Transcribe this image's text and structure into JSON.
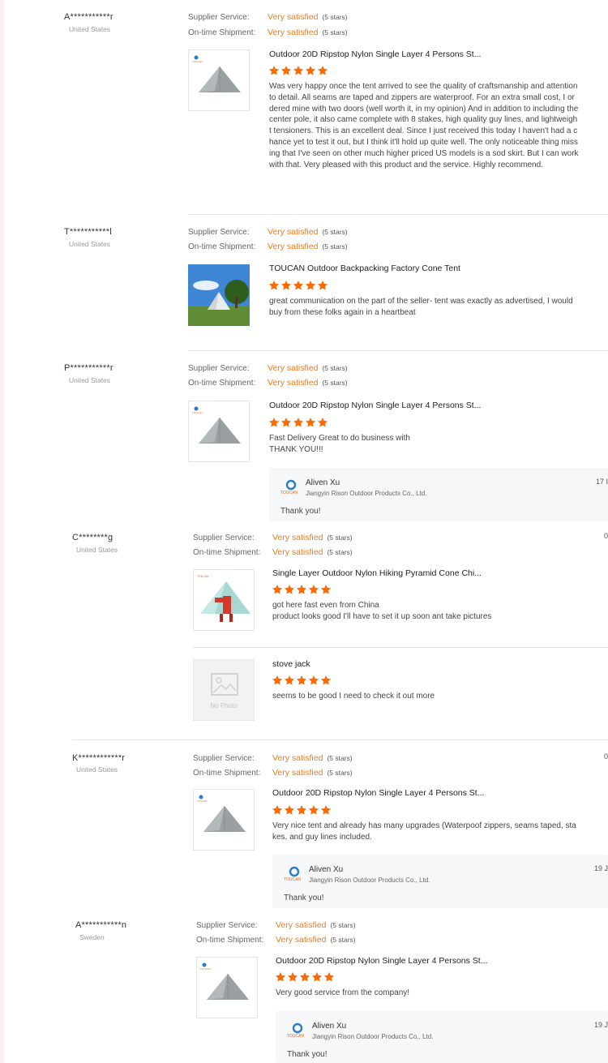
{
  "labels": {
    "supplier_service": "Supplier Service:",
    "ontime_shipment": "On-time Shipment:",
    "stars_note": "(5 stars)",
    "no_photo": "No Photo"
  },
  "reviews": [
    {
      "buyer": "A***********r",
      "country": "United States",
      "supplier_service": "Very satisfied",
      "ontime_shipment": "Very satisfied",
      "product_title": "Outdoor 20D Ripstop Nylon Single Layer 4 Persons St...",
      "rating": 5,
      "text": "Was very happy once the tent arrived to see the quality of craftsmanship and attention to detail. All seams are taped and zippers are waterproof. For an extra small cost, I ordered mine with two doors (well worth it, in my opinion) And in addition to including the center pole, it also came complete with 8 stakes, high quality guy lines, and lightweight tensioners. This is an excellent deal. Since I just received this today I haven't had a chance yet to test it out, but I think it'll hold up quite well. The only noticeable thing missing that I've seen on other much higher priced US models is a sod skirt. But I can work with that. Very pleased with this product and the service. Highly recommend."
    },
    {
      "buyer": "T***********l",
      "country": "United States",
      "supplier_service": "Very satisfied",
      "ontime_shipment": "Very satisfied",
      "product_title": "TOUCAN Outdoor Backpacking Factory Cone Tent",
      "rating": 5,
      "text": "great communication on the part of the seller- tent was exactly as advertised, I would buy from these folks again in a heartbeat"
    },
    {
      "buyer": "P***********r",
      "country": "United States",
      "supplier_service": "Very satisfied",
      "ontime_shipment": "Very satisfied",
      "product_title": "Outdoor 20D Ripstop Nylon Single Layer 4 Persons St...",
      "rating": 5,
      "text_line1": "Fast Delivery Great to do business with",
      "text_line2": "THANK YOU!!!",
      "reply": {
        "name": "Aliven Xu",
        "company": "Jiangyin Rison Outdoor Products Co., Ltd.",
        "message": "Thank you!",
        "date": "17 I"
      }
    },
    {
      "buyer": "C********g",
      "country": "United States",
      "supplier_service": "Very satisfied",
      "ontime_shipment": "Very satisfied",
      "edge_date": "0",
      "product_title": "Single Layer Outdoor Nylon Hiking Pyramid Cone Chi...",
      "rating": 5,
      "text_line1": "got here fast even from China",
      "text_line2": "product looks good I'll have to set it up soon ant take pictures",
      "extra_item": {
        "title": "stove jack",
        "rating": 5,
        "text": "seems to be good I need to check it out more"
      }
    },
    {
      "buyer": "K************r",
      "country": "United States",
      "supplier_service": "Very satisfied",
      "ontime_shipment": "Very satisfied",
      "edge_date": "0",
      "product_title": "Outdoor 20D Ripstop Nylon Single Layer 4 Persons St...",
      "rating": 5,
      "text": "Very nice tent and already has many upgrades (Waterpoof zippers, seams taped, stakes, and guy lines included.",
      "reply": {
        "name": "Aliven Xu",
        "company": "Jiangyin Rison Outdoor Products Co., Ltd.",
        "message": "Thank you!",
        "date": "19 J"
      }
    },
    {
      "buyer": "A***********n",
      "country": "Sweden",
      "supplier_service": "Very satisfied",
      "ontime_shipment": "Very satisfied",
      "product_title": "Outdoor 20D Ripstop Nylon Single Layer 4 Persons St...",
      "rating": 5,
      "text": "Very good service from the company!",
      "reply": {
        "name": "Aliven Xu",
        "company": "Jiangyin Rison Outdoor Products Co., Ltd.",
        "message": "Thank you!",
        "date": "19 J"
      }
    }
  ],
  "colors": {
    "accent": "#f27a14",
    "star": "#ff6a00",
    "reply_bg": "#f6f7f9",
    "separator": "#e4e4e4"
  }
}
